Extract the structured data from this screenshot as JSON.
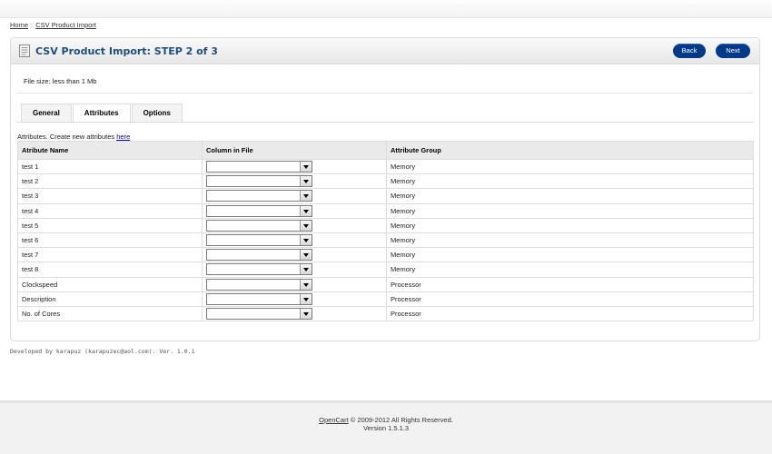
{
  "breadcrumb": {
    "home": "Home",
    "separator": "::",
    "current": "CSV Product Import"
  },
  "heading": {
    "title": "CSV Product Import: STEP 2 of 3",
    "icon": "document-icon",
    "back_label": "Back",
    "next_label": "Next"
  },
  "info": {
    "file_size": "File size: less than 1 Mb"
  },
  "tabs": [
    {
      "label": "General",
      "active": false
    },
    {
      "label": "Attributes",
      "active": true
    },
    {
      "label": "Options",
      "active": false
    }
  ],
  "attributes": {
    "note_text": "Attributes. Create new attributes",
    "note_link": "here",
    "headers": {
      "name": "Atribute Name",
      "column": "Column in File",
      "group": "Attribute Group"
    },
    "rows": [
      {
        "name": "test 1",
        "column": "",
        "group": "Memory"
      },
      {
        "name": "test 2",
        "column": "",
        "group": "Memory"
      },
      {
        "name": "test 3",
        "column": "",
        "group": "Memory"
      },
      {
        "name": "test 4",
        "column": "",
        "group": "Memory"
      },
      {
        "name": "test 5",
        "column": "",
        "group": "Memory"
      },
      {
        "name": "test 6",
        "column": "",
        "group": "Memory"
      },
      {
        "name": "test 7",
        "column": "",
        "group": "Memory"
      },
      {
        "name": "test 8",
        "column": "",
        "group": "Memory"
      },
      {
        "name": "Clockspeed",
        "column": "",
        "group": "Processor"
      },
      {
        "name": "Description",
        "column": "",
        "group": "Processor"
      },
      {
        "name": "No. of Cores",
        "column": "",
        "group": "Processor"
      }
    ]
  },
  "developed": "Developed by karapuz (karapuzec@aol.com). Ver. 1.0.1",
  "footer": {
    "link": "OpenCart",
    "copyright": " © 2009-2012 All Rights Reserved.",
    "version": "Version 1.5.1.3"
  },
  "colors": {
    "accent": "#003a88",
    "title": "#1c4e7f"
  }
}
